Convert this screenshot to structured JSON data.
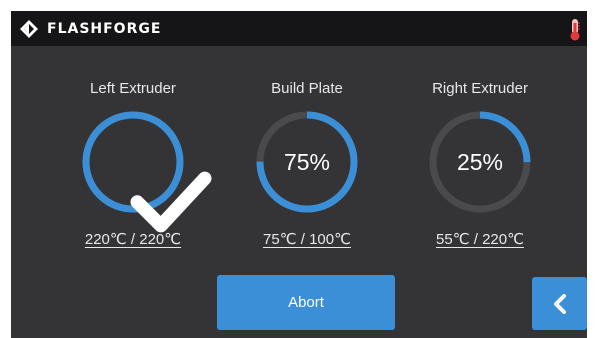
{
  "header": {
    "brand": "FLASHFORGE",
    "logo_icon": "flashforge-diamond-logo",
    "status_icon": "thermometer-icon"
  },
  "colors": {
    "accent": "#3b8fd6",
    "ring_track": "#4a4a4d",
    "background": "#343437",
    "header": "#151517"
  },
  "gauges": [
    {
      "title": "Left Extruder",
      "progress": 1.0,
      "center_icon": "check-icon",
      "temp": "220℃ / 220℃"
    },
    {
      "title": "Build Plate",
      "progress": 0.75,
      "value": "75%",
      "temp": "75℃ / 100℃"
    },
    {
      "title": "Right Extruder",
      "progress": 0.25,
      "value": "25%",
      "temp": "55℃ / 220℃"
    }
  ],
  "actions": {
    "abort_label": "Abort",
    "back_icon": "chevron-left-icon"
  }
}
